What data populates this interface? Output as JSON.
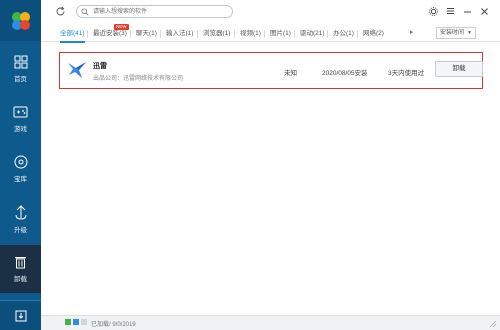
{
  "sidebar": {
    "items": [
      {
        "label": "首页",
        "icon": "home-icon"
      },
      {
        "label": "游戏",
        "icon": "gamepad-icon"
      },
      {
        "label": "宝库",
        "icon": "treasure-disc-icon"
      },
      {
        "label": "升级",
        "icon": "upgrade-arrow-icon"
      },
      {
        "label": "卸载",
        "icon": "trash-icon"
      }
    ],
    "active_index": 4
  },
  "search": {
    "placeholder": "请输入想搜索的软件"
  },
  "tabs": [
    {
      "label": "全部(41)"
    },
    {
      "label": "最近安装(3)"
    },
    {
      "label": "聊天(1)"
    },
    {
      "label": "输入法(1)"
    },
    {
      "label": "浏览器(1)"
    },
    {
      "label": "视频(1)"
    },
    {
      "label": "图片(1)"
    },
    {
      "label": "驱动(21)"
    },
    {
      "label": "办公(1)"
    },
    {
      "label": "网络(2)"
    }
  ],
  "new_badge": "NEW",
  "sort": {
    "label": "安装时间"
  },
  "apps": [
    {
      "name": "迅雷",
      "vendor": "出品公司：迅雷网络技术有限公司",
      "size": "未知",
      "install_date": "2020/08/05安装",
      "usage": "3天内使用过",
      "action": "卸载"
    }
  ],
  "status": {
    "text": "已加载/ 9/0/2019"
  },
  "colors": {
    "sidebar": "#0e5a8c",
    "active_nav": "#1b2f45",
    "accent": "#1f8ad2",
    "highlight_border": "#e0312e"
  }
}
